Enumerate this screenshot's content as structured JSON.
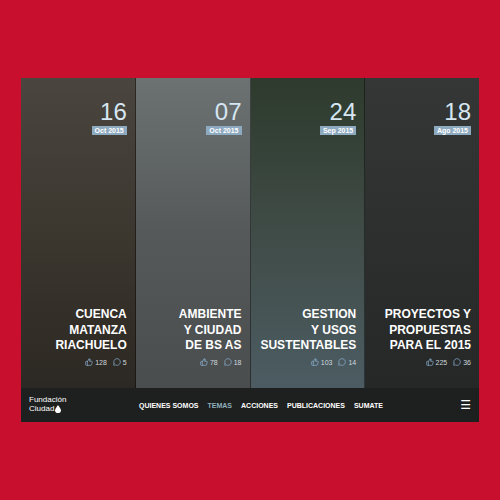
{
  "panels": [
    {
      "day": "16",
      "month": "Oct 2015",
      "title": [
        "CUENCA",
        "MATANZA",
        "RIACHUELO"
      ],
      "likes": "128",
      "comments": "5"
    },
    {
      "day": "07",
      "month": "Oct 2015",
      "title": [
        "AMBIENTE",
        "Y CIUDAD",
        "DE BS AS"
      ],
      "likes": "78",
      "comments": "18"
    },
    {
      "day": "24",
      "month": "Sep 2015",
      "title": [
        "GESTION",
        "Y USOS",
        "SUSTENTABLES"
      ],
      "likes": "103",
      "comments": "14"
    },
    {
      "day": "18",
      "month": "Ago 2015",
      "title": [
        "PROYECTOS Y",
        "PROPUESTAS",
        "PARA EL 2015"
      ],
      "likes": "225",
      "comments": "36"
    }
  ],
  "logo": {
    "line1": "Fundación",
    "line2": "Ciudad"
  },
  "nav": [
    {
      "label": "QUIENES SOMOS",
      "selected": false
    },
    {
      "label": "TEMAS",
      "selected": true
    },
    {
      "label": "ACCIONES",
      "selected": false
    },
    {
      "label": "PUBLICACIONES",
      "selected": false
    },
    {
      "label": "SUMATE",
      "selected": false
    }
  ],
  "menu": "☰"
}
